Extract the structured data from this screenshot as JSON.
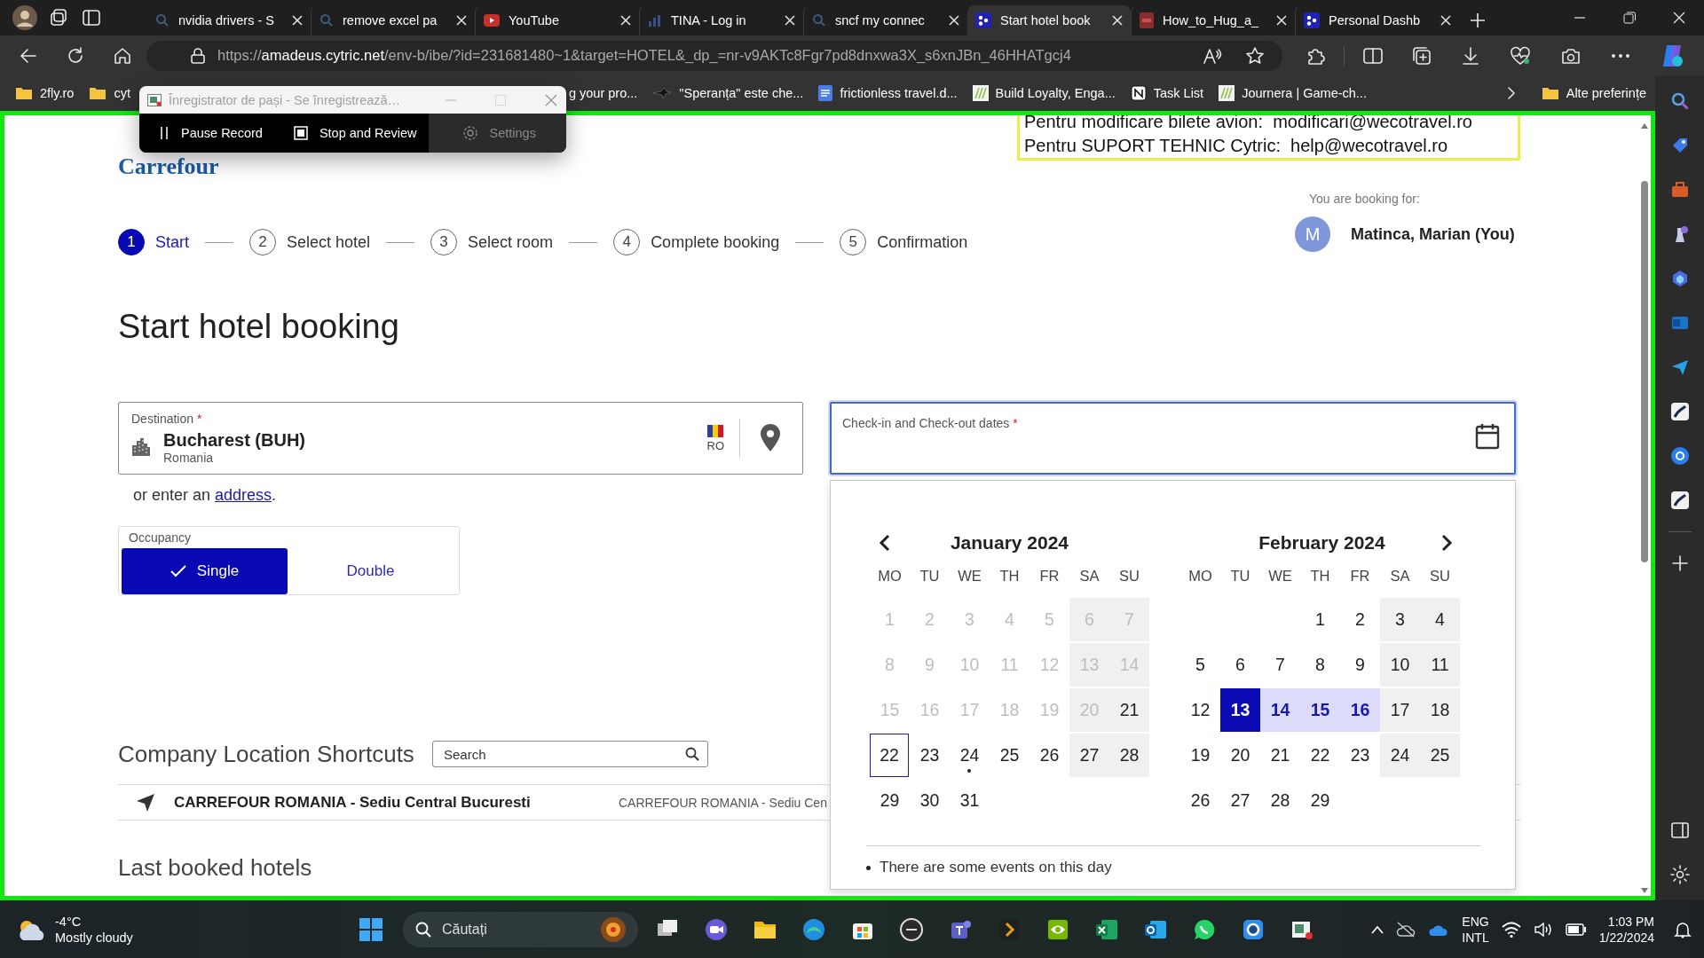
{
  "browser": {
    "tabs": [
      {
        "title": "nvidia drivers - S",
        "kind": "search",
        "selected": false
      },
      {
        "title": "remove excel pa",
        "kind": "search",
        "selected": false
      },
      {
        "title": "YouTube",
        "kind": "video",
        "selected": false
      },
      {
        "title": "TINA - Log in",
        "kind": "chart",
        "selected": false
      },
      {
        "title": "sncf my connec",
        "kind": "search",
        "selected": false
      },
      {
        "title": "Start hotel book",
        "kind": "dots",
        "selected": true
      },
      {
        "title": "How_to_Hug_a_",
        "kind": "pdf",
        "selected": false
      },
      {
        "title": "Personal Dashb",
        "kind": "dots",
        "selected": false
      }
    ],
    "url": {
      "scheme": "https://",
      "host": "amadeus.cytric.net",
      "path": "/env-b/ibe/?id=231681480~1&target=HOTEL&_dp_=nr-v9AKTc8Fgr7pd8dnxwa3X_s6xnJBn_46HHATgcj4"
    },
    "bookmarks": [
      {
        "label": "2fly.ro",
        "kind": "folder"
      },
      {
        "label": "cyt",
        "kind": "folder"
      },
      {
        "label": "g your pro...",
        "kind": "text"
      },
      {
        "label": "\"Speranța\" este che...",
        "kind": "bird"
      },
      {
        "label": "frictionless travel.d...",
        "kind": "doc"
      },
      {
        "label": "Build Loyalty, Enga...",
        "kind": "stripes"
      },
      {
        "label": "Task List",
        "kind": "notion"
      },
      {
        "label": "Journera | Game-ch...",
        "kind": "stripes"
      }
    ],
    "other_bookmarks": "Alte preferințe"
  },
  "recorder": {
    "title": "Înregistrator de pași - Se înregistrează…",
    "buttons": [
      {
        "label": "Pause Record",
        "kind": "pause",
        "disabled": false
      },
      {
        "label": "Stop and Review",
        "kind": "stop",
        "disabled": false
      },
      {
        "label": "Settings",
        "kind": "settings",
        "disabled": true
      }
    ]
  },
  "page": {
    "brand": "Carrefour",
    "notice_lines": [
      "Pentru modificare bilete avion:  modificari@wecotravel.ro",
      "Pentru SUPORT TEHNIC Cytric:  help@wecotravel.ro"
    ],
    "booking_for_label": "You are booking for:",
    "traveler": {
      "initial": "M",
      "name": "Matinca, Marian (You)"
    },
    "steps": [
      {
        "number": "1",
        "label": "Start",
        "selected": true
      },
      {
        "number": "2",
        "label": "Select hotel",
        "selected": false
      },
      {
        "number": "3",
        "label": "Select room",
        "selected": false
      },
      {
        "number": "4",
        "label": "Complete booking",
        "selected": false
      },
      {
        "number": "5",
        "label": "Confirmation",
        "selected": false
      }
    ],
    "title": "Start hotel booking",
    "destination": {
      "label": "Destination",
      "required_mark": "*",
      "value": "Bucharest (BUH)",
      "country": "Romania",
      "country_code": "RO"
    },
    "dates": {
      "label": "Check-in and Check-out dates",
      "required_mark": "*"
    },
    "address_hint": {
      "before": "or enter an ",
      "link": "address",
      "after": "."
    },
    "occupancy": {
      "label": "Occupancy",
      "options": [
        {
          "label": "Single",
          "selected": true
        },
        {
          "label": "Double",
          "selected": false
        }
      ]
    },
    "shortcuts": {
      "title": "Company Location Shortcuts",
      "search_placeholder": "Search",
      "rows": [
        {
          "name": "CARREFOUR ROMANIA - Sediu Central Bucuresti",
          "detail": "CARREFOUR ROMANIA - Sediu Cen"
        }
      ]
    },
    "last_booked_title": "Last booked hotels",
    "calendar": {
      "months": [
        {
          "title": "January 2024",
          "weekdays": [
            "MO",
            "TU",
            "WE",
            "TH",
            "FR",
            "SA",
            "SU"
          ],
          "days": [
            {
              "day": "1",
              "kind": "disabled"
            },
            {
              "day": "2",
              "kind": "disabled"
            },
            {
              "day": "3",
              "kind": "disabled"
            },
            {
              "day": "4",
              "kind": "disabled"
            },
            {
              "day": "5",
              "kind": "disabled"
            },
            {
              "day": "6",
              "kind": "disabled"
            },
            {
              "day": "7",
              "kind": "disabled"
            },
            {
              "day": "8",
              "kind": "disabled"
            },
            {
              "day": "9",
              "kind": "disabled"
            },
            {
              "day": "10",
              "kind": "disabled"
            },
            {
              "day": "11",
              "kind": "disabled"
            },
            {
              "day": "12",
              "kind": "disabled"
            },
            {
              "day": "13",
              "kind": "disabled"
            },
            {
              "day": "14",
              "kind": "disabled"
            },
            {
              "day": "15",
              "kind": "disabled"
            },
            {
              "day": "16",
              "kind": "disabled"
            },
            {
              "day": "17",
              "kind": "disabled"
            },
            {
              "day": "18",
              "kind": "disabled"
            },
            {
              "day": "19",
              "kind": "disabled"
            },
            {
              "day": "20",
              "kind": "disabled"
            },
            {
              "day": "21",
              "kind": "available"
            },
            {
              "day": "22",
              "kind": "today"
            },
            {
              "day": "23",
              "kind": "available"
            },
            {
              "day": "24",
              "kind": "event"
            },
            {
              "day": "25",
              "kind": "available"
            },
            {
              "day": "26",
              "kind": "available"
            },
            {
              "day": "27",
              "kind": "available"
            },
            {
              "day": "28",
              "kind": "available"
            },
            {
              "day": "29",
              "kind": "available"
            },
            {
              "day": "30",
              "kind": "available"
            },
            {
              "day": "31",
              "kind": "available"
            }
          ]
        },
        {
          "title": "February 2024",
          "weekdays": [
            "MO",
            "TU",
            "WE",
            "TH",
            "FR",
            "SA",
            "SU"
          ],
          "days": [
            {
              "kind": "blank"
            },
            {
              "kind": "blank"
            },
            {
              "kind": "blank"
            },
            {
              "day": "1",
              "kind": "available"
            },
            {
              "day": "2",
              "kind": "available"
            },
            {
              "day": "3",
              "kind": "available"
            },
            {
              "day": "4",
              "kind": "available"
            },
            {
              "day": "5",
              "kind": "available"
            },
            {
              "day": "6",
              "kind": "available"
            },
            {
              "day": "7",
              "kind": "available"
            },
            {
              "day": "8",
              "kind": "available"
            },
            {
              "day": "9",
              "kind": "available"
            },
            {
              "day": "10",
              "kind": "available"
            },
            {
              "day": "11",
              "kind": "available"
            },
            {
              "day": "12",
              "kind": "available"
            },
            {
              "day": "13",
              "kind": "range-start"
            },
            {
              "day": "14",
              "kind": "in-range"
            },
            {
              "day": "15",
              "kind": "in-range"
            },
            {
              "day": "16",
              "kind": "in-range"
            },
            {
              "day": "17",
              "kind": "available"
            },
            {
              "day": "18",
              "kind": "available"
            },
            {
              "day": "19",
              "kind": "available"
            },
            {
              "day": "20",
              "kind": "available"
            },
            {
              "day": "21",
              "kind": "available"
            },
            {
              "day": "22",
              "kind": "available"
            },
            {
              "day": "23",
              "kind": "available"
            },
            {
              "day": "24",
              "kind": "available"
            },
            {
              "day": "25",
              "kind": "available"
            },
            {
              "day": "26",
              "kind": "available"
            },
            {
              "day": "27",
              "kind": "available"
            },
            {
              "day": "28",
              "kind": "available"
            },
            {
              "day": "29",
              "kind": "available"
            }
          ]
        }
      ],
      "legend": "There are some events on this day"
    }
  },
  "taskbar": {
    "temperature": "-4°C",
    "weather": "Mostly cloudy",
    "search_placeholder": "Căutați",
    "language": "ENG",
    "layout": "INTL",
    "time": "1:03 PM",
    "date": "1/22/2024"
  }
}
